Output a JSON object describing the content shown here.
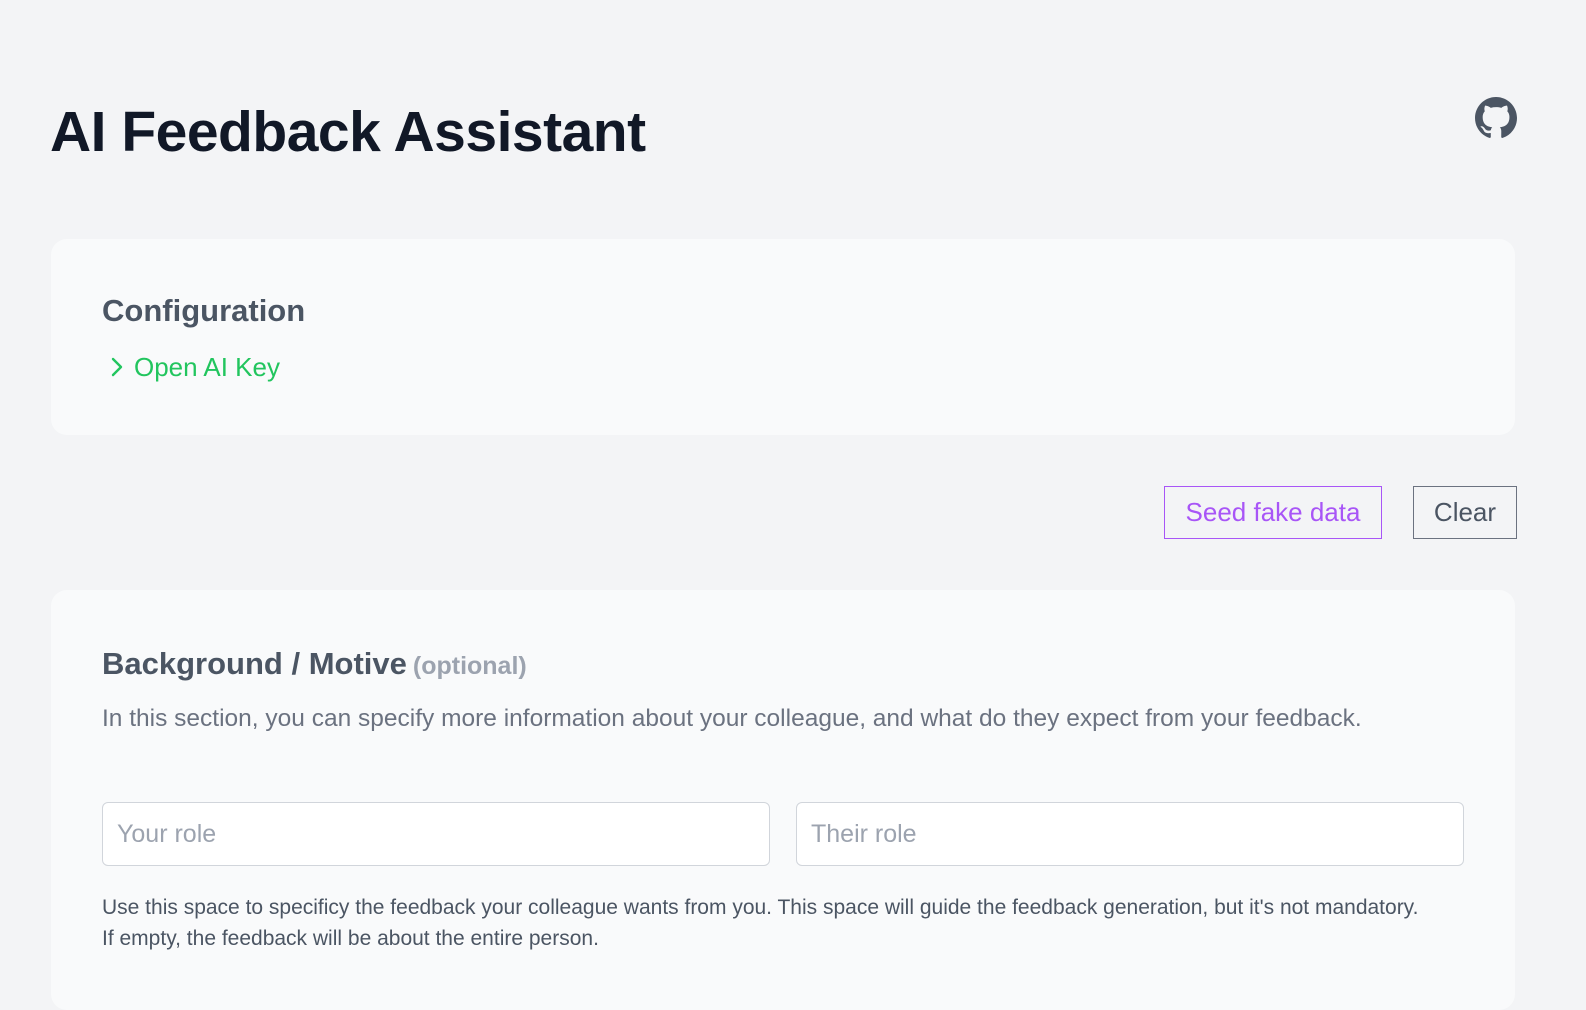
{
  "header": {
    "title": "AI Feedback Assistant",
    "github_icon": "github-icon"
  },
  "configuration": {
    "title": "Configuration",
    "toggle_label": "Open AI Key",
    "toggle_icon": "chevron-right-icon",
    "accent_color": "#22c55e"
  },
  "actions": {
    "seed_label": "Seed fake data",
    "seed_color": "#a855f7",
    "clear_label": "Clear"
  },
  "background": {
    "title": "Background / Motive",
    "optional_label": "(optional)",
    "description": "In this section, you can specify more information about your colleague, and what do they expect from your feedback.",
    "your_role_placeholder": "Your role",
    "their_role_placeholder": "Their role",
    "your_role_value": "",
    "their_role_value": "",
    "hint_line1": "Use this space to specificy the feedback your colleague wants from you. This space will guide the feedback generation, but it's not mandatory.",
    "hint_line2": "If empty, the feedback will be about the entire person."
  }
}
